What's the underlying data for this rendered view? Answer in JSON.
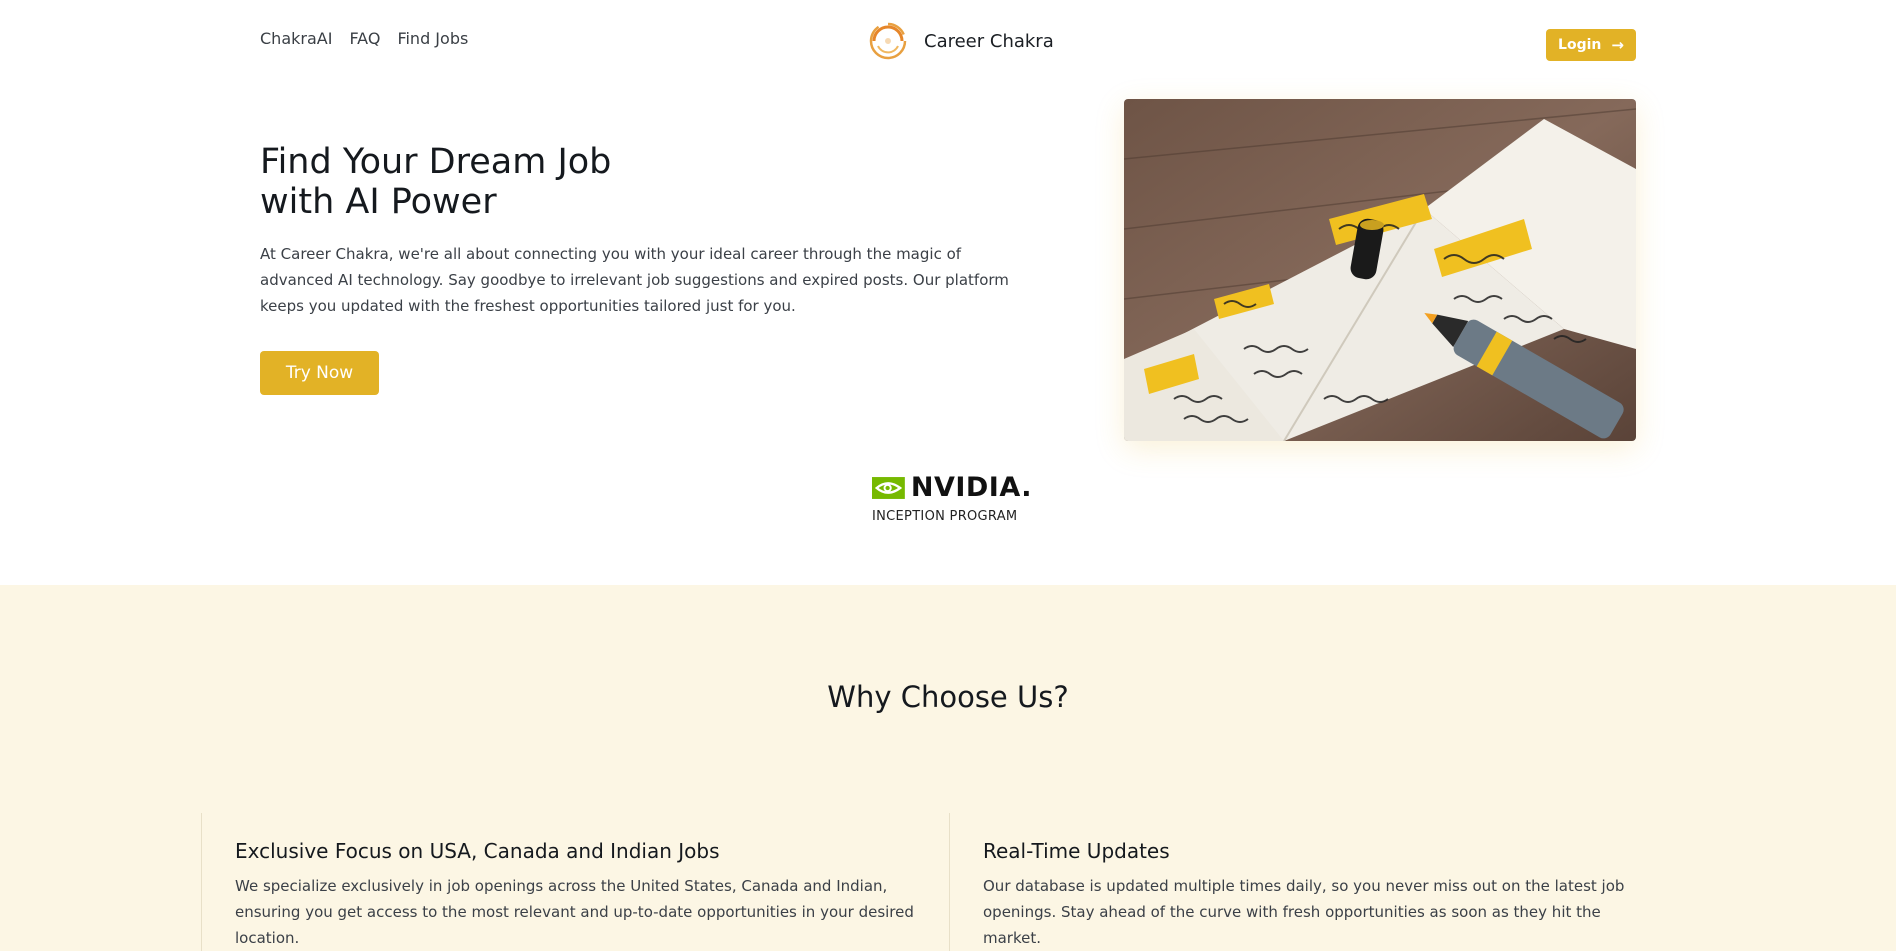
{
  "nav": {
    "links": [
      {
        "label": "ChakraAI"
      },
      {
        "label": "FAQ"
      },
      {
        "label": "Find Jobs"
      }
    ],
    "brand_name": "Career Chakra",
    "login_label": "Login",
    "login_icon": "arrow-right-icon"
  },
  "hero": {
    "title_line1": "Find Your Dream Job",
    "title_line2": "with AI Power",
    "description": "At Career Chakra, we're all about connecting you with your ideal career through the magic of advanced AI technology. Say goodbye to irrelevant job suggestions and expired posts. Our platform keeps you updated with the freshest opportunities tailored just for you.",
    "cta_label": "Try Now",
    "image_alt": "Notebook with goals and planning notes and a marker"
  },
  "partner": {
    "logo_text": "NVIDIA.",
    "sub_text": "INCEPTION PROGRAM"
  },
  "why": {
    "title": "Why Choose Us?",
    "cards": [
      {
        "title": "Exclusive Focus on USA, Canada and Indian Jobs",
        "text": "We specialize exclusively in job openings across the United States, Canada and Indian, ensuring you get access to the most relevant and up-to-date opportunities in your desired location."
      },
      {
        "title": "Real-Time Updates",
        "text": "Our database is updated multiple times daily, so you never miss out on the latest job openings. Stay ahead of the curve with fresh opportunities as soon as they hit the market."
      }
    ]
  },
  "colors": {
    "accent": "#e2b226",
    "section_bg": "#fcf6e4",
    "nvidia_green": "#76b900"
  }
}
